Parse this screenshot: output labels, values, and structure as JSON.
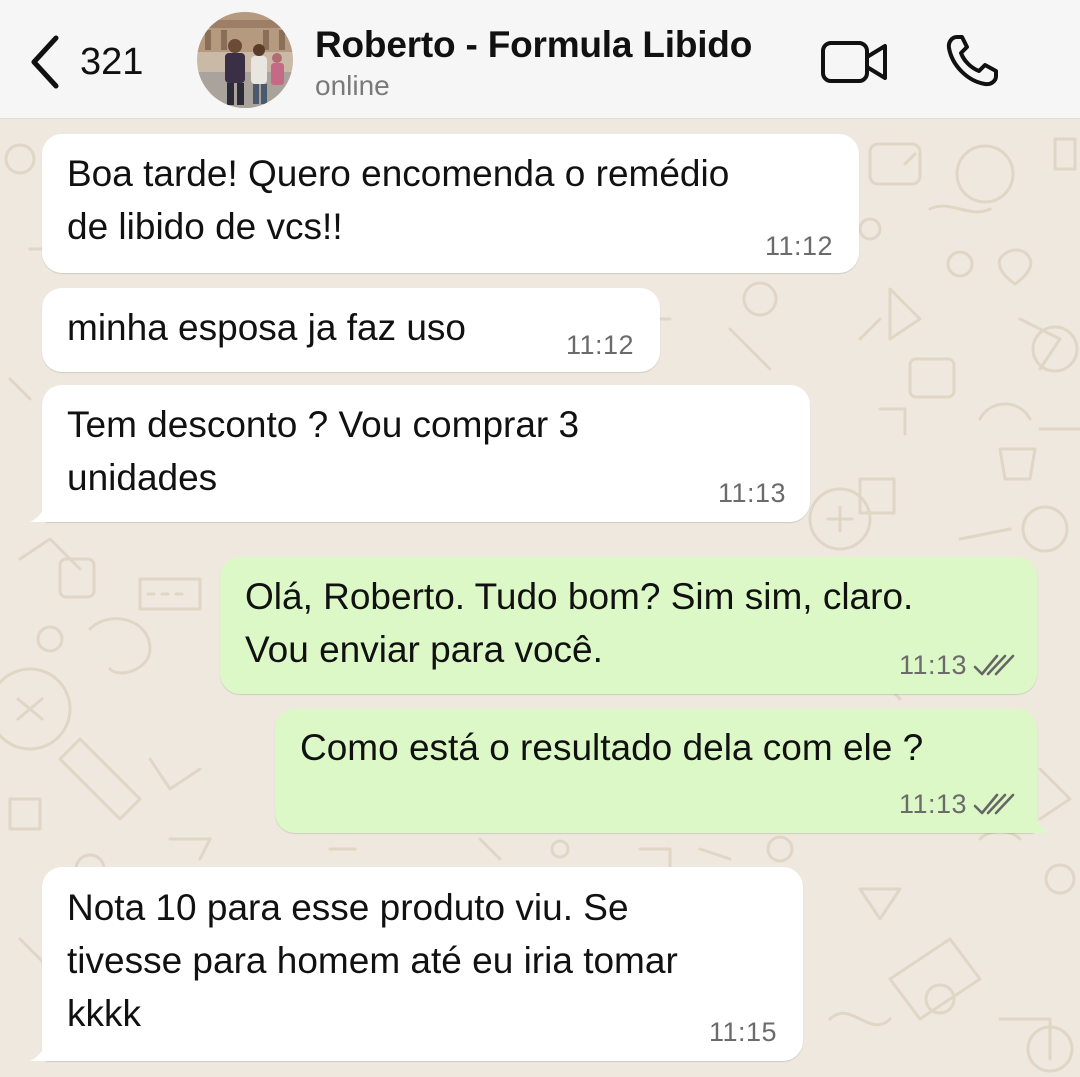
{
  "header": {
    "back_count": "321",
    "contact_name": "Roberto - Formula Libido",
    "status": "online"
  },
  "messages": [
    {
      "direction": "in",
      "text": "Boa tarde! Quero encomenda o remédio\nde libido de vcs!!",
      "time": "11:12"
    },
    {
      "direction": "in",
      "text": "minha esposa ja faz uso",
      "time": "11:12"
    },
    {
      "direction": "in",
      "text": "Tem desconto ? Vou comprar 3\nunidades",
      "time": "11:13"
    },
    {
      "direction": "out",
      "text": "Olá, Roberto. Tudo bom? Sim sim, claro.\nVou enviar para você.",
      "time": "11:13",
      "status": "read"
    },
    {
      "direction": "out",
      "text": "Como está o resultado dela com ele ?",
      "time": "11:13",
      "status": "read"
    },
    {
      "direction": "in",
      "text": "Nota 10 para esse produto viu. Se\ntivesse para homem até eu iria tomar\nkkkk",
      "time": "11:15"
    }
  ],
  "colors": {
    "incoming_bubble": "#ffffff",
    "outgoing_bubble": "#dcf8c6",
    "chat_background": "#efe8de",
    "header_background": "#f6f6f6",
    "read_ticks": "#666666"
  }
}
